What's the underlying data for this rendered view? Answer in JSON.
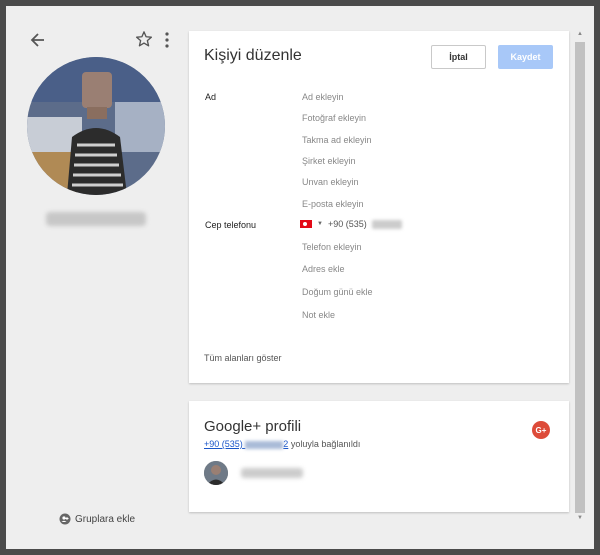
{
  "header": {
    "back_icon": "arrow-left-icon",
    "star_icon": "star-outline-icon",
    "more_icon": "more-vertical-icon"
  },
  "left_panel": {
    "groups_button_label": "Gruplara ekle",
    "groups_icon": "people-icon"
  },
  "edit": {
    "title": "Kişiyi düzenle",
    "cancel_label": "İptal",
    "save_label": "Kaydet",
    "name_section_label": "Ad",
    "mobile_section_label": "Cep telefonu",
    "fields": {
      "add_name": "Ad ekleyin",
      "add_photo": "Fotoğraf ekleyin",
      "add_nickname": "Takma ad ekleyin",
      "add_company": "Şirket ekleyin",
      "add_title": "Unvan ekleyin",
      "add_email": "E-posta ekleyin",
      "add_phone": "Telefon ekleyin",
      "add_address": "Adres ekle",
      "add_birthday": "Doğum günü ekle",
      "add_note": "Not ekle"
    },
    "phone_value": "+90 (535)",
    "show_all_label": "Tüm alanları göster"
  },
  "gplus": {
    "title": "Google+ profili",
    "badge": "G+",
    "linked_number_prefix": "+90 (535)",
    "linked_number_suffix": "2",
    "linked_text": "yoluyla bağlanıldı"
  },
  "colors": {
    "save_button": "#a8c8f8",
    "link": "#1a56c9",
    "gplus_red": "#dd4b39",
    "turkey_flag": "#e30a17"
  }
}
